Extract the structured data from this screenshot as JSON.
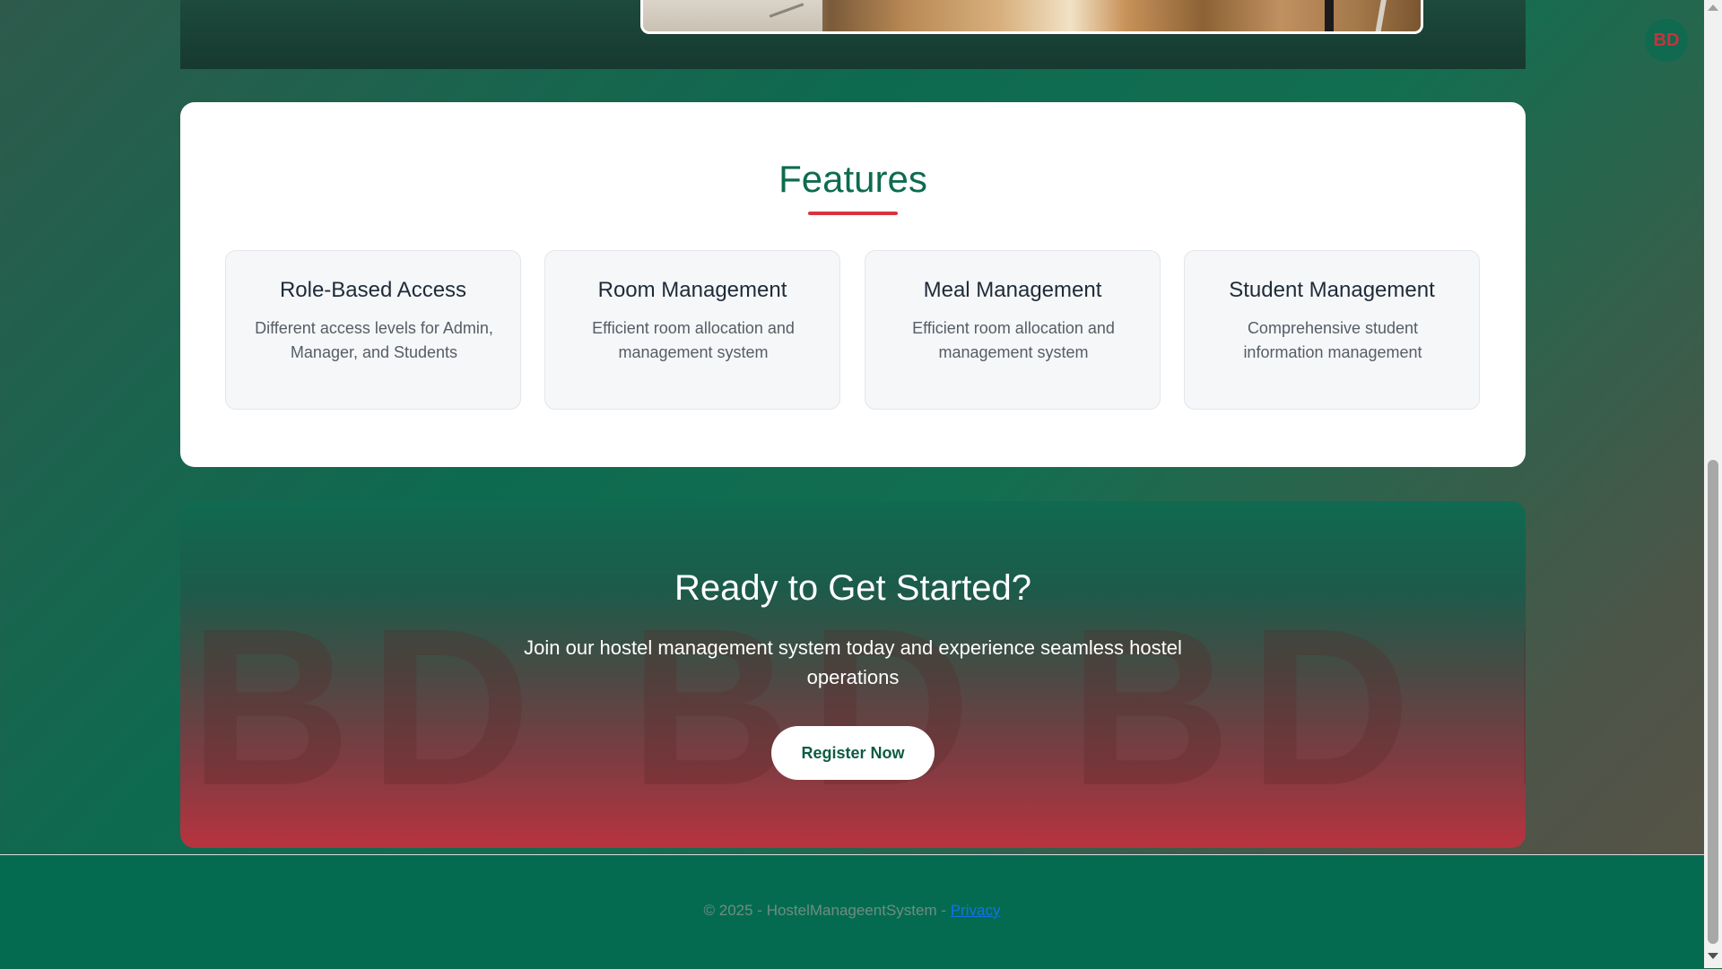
{
  "header": {
    "avatar_initials": "BD"
  },
  "features": {
    "title": "Features",
    "items": [
      {
        "title": "Role-Based Access",
        "description": "Different access levels for Admin, Manager, and Students"
      },
      {
        "title": "Room Management",
        "description": "Efficient room allocation and management system"
      },
      {
        "title": "Meal Management",
        "description": "Efficient room allocation and management system"
      },
      {
        "title": "Student Management",
        "description": "Comprehensive student information management"
      }
    ]
  },
  "cta": {
    "watermark": "BD BD BD BD",
    "title": "Ready to Get Started?",
    "text": "Join our hostel management system today and experience seamless hostel operations",
    "button_label": "Register Now"
  },
  "footer": {
    "copyright": "© 2025 - HostelManageentSystem - ",
    "privacy_label": "Privacy"
  },
  "colors": {
    "brand_green": "#0d6b50",
    "accent_red": "#d8343f",
    "footer_bg": "#046b50",
    "link": "#1572e8"
  }
}
